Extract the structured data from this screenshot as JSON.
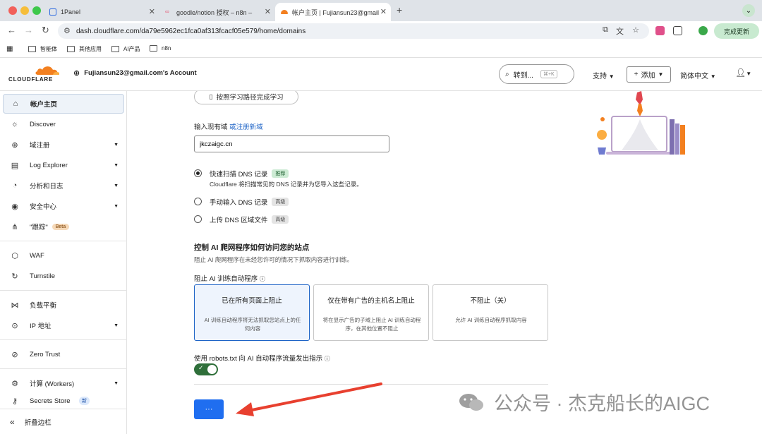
{
  "browser": {
    "tabs": [
      {
        "title": "1Panel"
      },
      {
        "title": "goodle/notion 授权 – n8n –"
      },
      {
        "title": "帐户主页 | Fujiansun23@gmail"
      }
    ],
    "url": "dash.cloudflare.com/da79e5962ec1fca0af313fcacf05e579/home/domains",
    "update_label": "完成更新",
    "bookmarks": [
      "智能体",
      "其他应用",
      "AI产品",
      "n8n"
    ]
  },
  "header": {
    "logo_text": "CLOUDFLARE",
    "account": "Fujiansun23@gmail.com's Account",
    "goto_label": "转到...",
    "goto_kbd": "⌘+K",
    "support": "支持",
    "add": "添加",
    "language": "简体中文"
  },
  "sidebar": {
    "items": [
      {
        "label": "帐户主页",
        "icon": "home-icon"
      },
      {
        "label": "Discover",
        "icon": "bulb-icon"
      },
      {
        "label": "域注册",
        "icon": "globe-icon"
      },
      {
        "label": "Log Explorer",
        "icon": "log-icon"
      },
      {
        "label": "分析和日志",
        "icon": "chart-icon"
      },
      {
        "label": "安全中心",
        "icon": "shield-icon"
      },
      {
        "label": "\"跟踪\"",
        "icon": "trace-icon",
        "badge": "Beta"
      },
      {
        "label": "WAF",
        "icon": "waf-icon"
      },
      {
        "label": "Turnstile",
        "icon": "turnstile-icon"
      },
      {
        "label": "负载平衡",
        "icon": "balance-icon"
      },
      {
        "label": "IP 地址",
        "icon": "location-icon"
      },
      {
        "label": "Zero Trust",
        "icon": "zerotrust-icon"
      },
      {
        "label": "计算 (Workers)",
        "icon": "compute-icon"
      },
      {
        "label": "Secrets Store",
        "icon": "secrets-icon",
        "badge": "新"
      }
    ],
    "collapse_label": "折叠边栏"
  },
  "main": {
    "learning_path": "按照学习路径完成学习",
    "input_label": "输入现有域",
    "register_link": "或注册新域",
    "domain_value": "jkczaigc.cn",
    "options": [
      {
        "label": "快速扫描 DNS 记录",
        "tag": "推荐",
        "desc": "Cloudflare 将扫描常见的 DNS 记录并为您导入这些记录。",
        "selected": true
      },
      {
        "label": "手动输入 DNS 记录",
        "tag": "高级",
        "selected": false
      },
      {
        "label": "上传 DNS 区域文件",
        "tag": "高级",
        "selected": false
      }
    ],
    "ai_title": "控制 AI 爬网程序如何访问您的站点",
    "ai_sub": "阻止 AI 爬网程序在未经您许可的情况下抓取内容进行训练。",
    "block_label": "阻止 AI 训练自动程序",
    "cards": [
      {
        "title": "已在所有页面上阻止",
        "desc": "AI 训练自动程序将无法抓取您站点上的任何内容"
      },
      {
        "title": "仅在带有广告的主机名上阻止",
        "desc": "将在显示广告的子域上阻止 AI 训练自动程序，在其他位置不阻止"
      },
      {
        "title": "不阻止（关）",
        "desc": "允许 AI 训练自动程序抓取内容"
      }
    ],
    "robots_label": "使用 robots.txt 向 AI 自动程序流量发出指示",
    "robots_enabled": true,
    "submit_label": "···"
  },
  "watermark": "公众号 · 杰克船长的AIGC"
}
